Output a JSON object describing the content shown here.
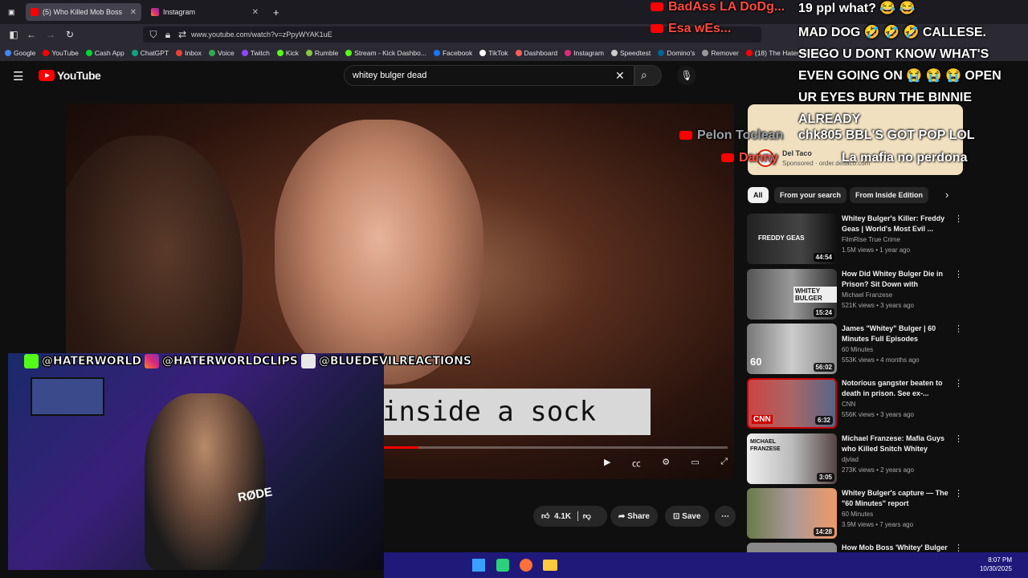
{
  "browser": {
    "tabs": [
      {
        "label": "(5) Who Killed Mob Boss 'W",
        "active": true
      },
      {
        "label": "Instagram",
        "active": false
      }
    ],
    "new_tab": "+",
    "url": "www.youtube.com/watch?v=zPpyWYAK1uE",
    "bookmarks": [
      "Google",
      "YouTube",
      "Cash App",
      "ChatGPT",
      "Inbox",
      "Voice",
      "Twitch",
      "Kick",
      "Rumble",
      "Stream - Kick Dashbo...",
      "Facebook",
      "TikTok",
      "Dashboard",
      "Instagram",
      "Speedtest",
      "Domino's",
      "Remover",
      "(18) The Hater World"
    ]
  },
  "youtube": {
    "logo": "YouTube",
    "search_value": "whitey bulger dead",
    "video_caption": "inside a sock",
    "actions": {
      "likes": "4.1K",
      "share": "Share",
      "save": "Save"
    },
    "ad": {
      "brand": "Del Taco",
      "sponsored": "Sponsored",
      "domain": "order.deltaco.com"
    },
    "chips": [
      "All",
      "From your search",
      "From Inside Edition"
    ],
    "recommendations": [
      {
        "title": "Whitey Bulger's Killer: Freddy Geas | World's Most Evil ...",
        "channel": "FilmRise True Crime",
        "meta": "1.5M views • 1 year ago",
        "duration": "44:54",
        "thumb_text": "FREDDY GEAS"
      },
      {
        "title": "How Did Whitey Bulger Die in Prison? Sit Down with Michael...",
        "channel": "Michael Franzese",
        "meta": "521K views • 3 years ago",
        "duration": "15:24",
        "thumb_text": "WHITEY BULGER"
      },
      {
        "title": "James \"Whitey\" Bulger | 60 Minutes Full Episodes",
        "channel": "60 Minutes",
        "meta": "553K views • 4 months ago",
        "duration": "56:02",
        "thumb_text": "60"
      },
      {
        "title": "Notorious gangster beaten to death in prison. See ex-...",
        "channel": "CNN",
        "meta": "556K views • 3 years ago",
        "duration": "6:32",
        "thumb_text": "CNN"
      },
      {
        "title": "Michael Franzese: Mafia Guys who Killed Snitch Whitey Bulg...",
        "channel": "djvlad",
        "meta": "273K views • 2 years ago",
        "duration": "3:05",
        "thumb_text": "MICHAEL FRANZESE"
      },
      {
        "title": "Whitey Bulger's capture — The \"60 Minutes\" report",
        "channel": "60 Minutes",
        "meta": "3.9M views • 7 years ago",
        "duration": "14:28",
        "thumb_text": ""
      },
      {
        "title": "How Mob Boss 'Whitey' Bulger",
        "channel": "",
        "meta": "",
        "duration": "",
        "thumb_text": ""
      }
    ]
  },
  "stream_overlay": {
    "handles": [
      "@HATERWORLD",
      "@HATERWORLDCLIPS",
      "@BLUEDEVILREACTIONS"
    ],
    "mic_label": "RØDE",
    "chat": [
      {
        "user": "BadAss LA DoDg...",
        "message": "19 ppl what? 😂 😂"
      },
      {
        "user": "Esa wEs...",
        "message": "MAD DOG 🤣 🤣 🤣 CALLESE. SIEGO U DONT KNOW WHAT'S EVEN GOING ON 😭 😭 😭 OPEN UR EYES BURN THE BINNIE ALREADY"
      },
      {
        "user": "Pelon Toclean",
        "message": "chk805 BBL'S GOT POP LOL"
      },
      {
        "user": "Danny",
        "message": "La mafia no perdona"
      }
    ]
  },
  "taskbar": {
    "time": "8:07 PM",
    "date": "10/30/2025"
  },
  "colors": {
    "yt_red": "#ff0000",
    "bg": "#0f0f0f",
    "taskbar": "#1f1a7a"
  }
}
